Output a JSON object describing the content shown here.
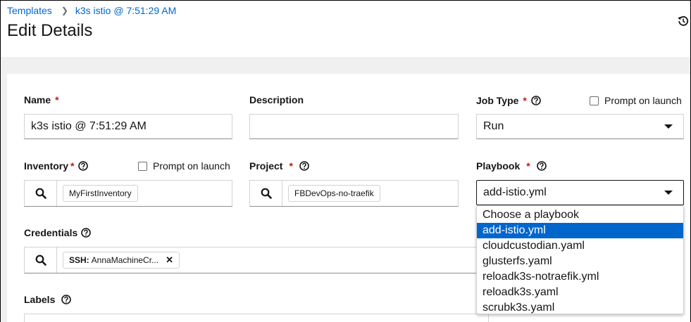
{
  "breadcrumb": {
    "root": "Templates",
    "current": "k3s istio @ 7:51:29 AM"
  },
  "page_title": "Edit Details",
  "form": {
    "name": {
      "label": "Name",
      "value": "k3s istio @ 7:51:29 AM"
    },
    "description": {
      "label": "Description",
      "value": ""
    },
    "job_type": {
      "label": "Job Type",
      "value": "Run",
      "prompt_label": "Prompt on launch"
    },
    "inventory": {
      "label": "Inventory",
      "chip": "MyFirstInventory",
      "prompt_label": "Prompt on launch"
    },
    "project": {
      "label": "Project",
      "chip": "FBDevOps-no-traefik"
    },
    "playbook": {
      "label": "Playbook",
      "value": "add-istio.yml",
      "options": [
        "Choose a playbook",
        "add-istio.yml",
        "cloudcustodian.yaml",
        "glusterfs.yaml",
        "reloadk3s-notraefik.yml",
        "reloadk3s.yaml",
        "scrubk3s.yaml"
      ],
      "selected_option": "add-istio.yml"
    },
    "credentials": {
      "label": "Credentials",
      "chip_prefix": "SSH:",
      "chip_value": "AnnaMachineCr..."
    },
    "labels": {
      "label": "Labels"
    }
  },
  "icons": {
    "history": "history-icon",
    "search": "search-icon",
    "help": "help-icon",
    "close": "close-icon",
    "caret": "caret-down-icon"
  },
  "colors": {
    "link": "#0066cc",
    "required": "#c9190b",
    "selected": "#0066cc"
  }
}
